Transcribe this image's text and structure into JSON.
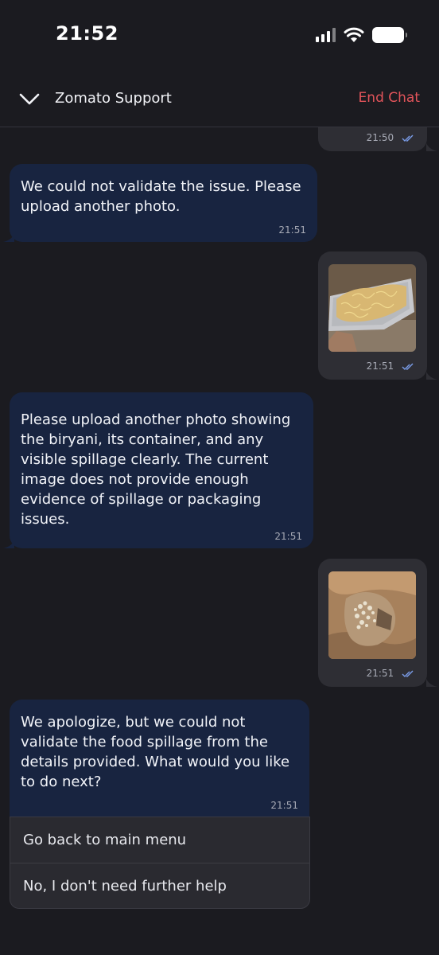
{
  "status_bar": {
    "time": "21:52"
  },
  "header": {
    "title": "Zomato Support",
    "end_chat_label": "End Chat"
  },
  "messages": [
    {
      "direction": "outgoing",
      "time": "21:50",
      "read": true
    },
    {
      "direction": "incoming",
      "text": "We could not validate the issue. Please upload another photo.",
      "time": "21:51"
    },
    {
      "direction": "outgoing",
      "image": "biryani-in-foil-container-photo",
      "time": "21:51",
      "read": true
    },
    {
      "direction": "incoming",
      "text": "Please upload another photo showing the biryani, its container, and any visible spillage clearly. The current image does not provide enough evidence of spillage or packaging issues.",
      "time": "21:51"
    },
    {
      "direction": "outgoing",
      "image": "food-spillage-in-paper-bag-photo",
      "time": "21:51",
      "read": true
    },
    {
      "direction": "incoming",
      "text": "We apologize, but we could not validate the food spillage from the details provided. What would you like to do next?",
      "time": "21:51"
    }
  ],
  "quick_replies": [
    {
      "label": "Go back to main menu"
    },
    {
      "label": "No, I don't need further help"
    }
  ],
  "colors": {
    "background": "#1b1b20",
    "incoming_bubble": "#182440",
    "outgoing_bubble": "#2e2e34",
    "end_chat": "#e2545a",
    "read_ticks": "#7a9ce8"
  }
}
